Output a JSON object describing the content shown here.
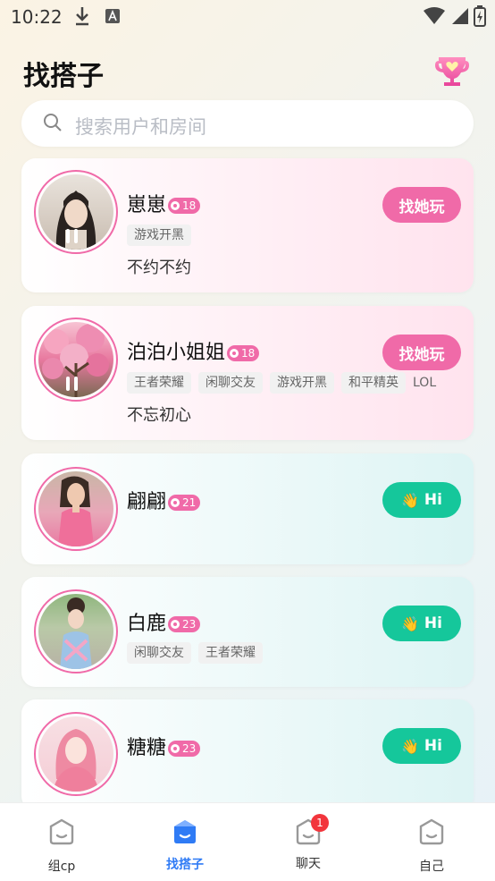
{
  "status_bar": {
    "time": "10:22"
  },
  "header": {
    "title": "找搭子"
  },
  "search": {
    "placeholder": "搜索用户和房间"
  },
  "users": [
    {
      "name": "崽崽",
      "age": "18",
      "tags": [
        "游戏开黑"
      ],
      "signature": "不约不约",
      "action": "找她玩"
    },
    {
      "name": "泊泊小姐姐",
      "age": "18",
      "tags": [
        "王者荣耀",
        "闲聊交友",
        "游戏开黑",
        "和平精英",
        "LOL"
      ],
      "signature": "不忘初心",
      "action": "找她玩"
    },
    {
      "name": "翩翩",
      "age": "21",
      "tags": [],
      "signature": "",
      "action": "Hi"
    },
    {
      "name": "白鹿",
      "age": "23",
      "tags": [
        "闲聊交友",
        "王者荣耀"
      ],
      "signature": "",
      "action": "Hi"
    },
    {
      "name": "糖糖",
      "age": "23",
      "tags": [],
      "signature": "",
      "action": "Hi"
    }
  ],
  "tabbar": {
    "tabs": [
      {
        "label": "组cp"
      },
      {
        "label": "找搭子"
      },
      {
        "label": "聊天",
        "badge": "1"
      },
      {
        "label": "自己"
      }
    ]
  },
  "colors": {
    "pink": "#f06aa8",
    "green": "#15c79b",
    "active_tab": "#2f7bf5"
  }
}
